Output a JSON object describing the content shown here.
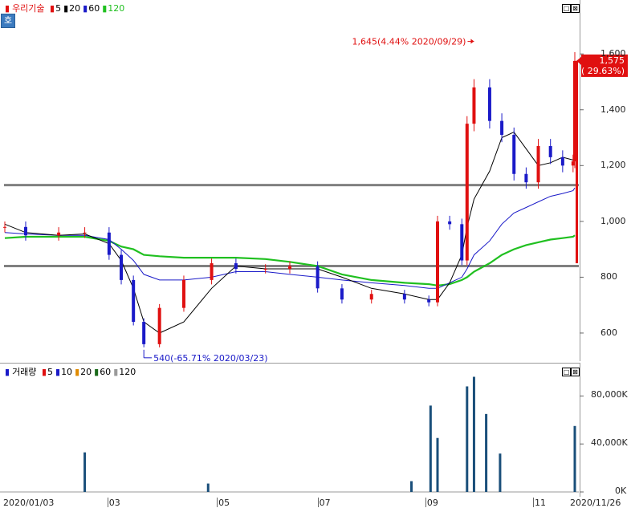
{
  "price_legend": {
    "stock_name": "우리기술",
    "ma_items": [
      {
        "label": "5",
        "color": "#e01010"
      },
      {
        "label": "20",
        "color": "#000000"
      },
      {
        "label": "60",
        "color": "#1a1ac8"
      },
      {
        "label": "120",
        "color": "#20c020"
      }
    ]
  },
  "volume_legend": {
    "title": "거래량",
    "ma_items": [
      {
        "label": "5",
        "color": "#e01010"
      },
      {
        "label": "10",
        "color": "#1a1ac8"
      },
      {
        "label": "20",
        "color": "#e08a00"
      },
      {
        "label": "60",
        "color": "#1a6a1a"
      },
      {
        "label": "120",
        "color": "#9a9a9a"
      }
    ]
  },
  "menu_chip": "호",
  "window_buttons": [
    "□",
    "⊠"
  ],
  "annotations": {
    "high": "1,645(4.44% 2020/09/29)",
    "low": "540(-65.71% 2020/03/23)",
    "last_price": "1,575",
    "last_change": "( 29.63%)"
  },
  "x_labels": {
    "start_date": "2020/01/03",
    "end_date": "2020/11/26",
    "months": [
      "03",
      "05",
      "07",
      "09",
      "11"
    ]
  },
  "colors": {
    "up": "#e01010",
    "down": "#1a1ac8",
    "support_line": "#808080",
    "ma120": "#20c020"
  },
  "chart_data": [
    {
      "type": "candlestick",
      "title": "우리기술",
      "y_ticks": [
        "1,600",
        "1,400",
        "1,200",
        "1,000",
        "800",
        "600"
      ],
      "y_tick_values": [
        1600,
        1400,
        1200,
        1000,
        800,
        600
      ],
      "ylim": [
        505,
        1730
      ],
      "horizontal_lines": [
        1130,
        840
      ],
      "close_series": [
        {
          "date": "2020/01/03",
          "close": 980
        },
        {
          "date": "2020/01/15",
          "close": 950
        },
        {
          "date": "2020/02/03",
          "close": 960
        },
        {
          "date": "2020/02/18",
          "close": 960
        },
        {
          "date": "2020/03/03",
          "close": 880
        },
        {
          "date": "2020/03/10",
          "close": 790
        },
        {
          "date": "2020/03/17",
          "close": 640
        },
        {
          "date": "2020/03/23",
          "close": 560
        },
        {
          "date": "2020/04/01",
          "close": 690
        },
        {
          "date": "2020/04/15",
          "close": 790
        },
        {
          "date": "2020/05/01",
          "close": 850
        },
        {
          "date": "2020/05/15",
          "close": 830
        },
        {
          "date": "2020/06/01",
          "close": 830
        },
        {
          "date": "2020/06/15",
          "close": 840
        },
        {
          "date": "2020/07/01",
          "close": 760
        },
        {
          "date": "2020/07/15",
          "close": 720
        },
        {
          "date": "2020/08/01",
          "close": 740
        },
        {
          "date": "2020/08/20",
          "close": 720
        },
        {
          "date": "2020/09/03",
          "close": 710
        },
        {
          "date": "2020/09/08",
          "close": 1000
        },
        {
          "date": "2020/09/15",
          "close": 990
        },
        {
          "date": "2020/09/22",
          "close": 860
        },
        {
          "date": "2020/09/25",
          "close": 1350
        },
        {
          "date": "2020/09/29",
          "close": 1480
        },
        {
          "date": "2020/10/08",
          "close": 1360
        },
        {
          "date": "2020/10/15",
          "close": 1310
        },
        {
          "date": "2020/10/22",
          "close": 1170
        },
        {
          "date": "2020/10/29",
          "close": 1140
        },
        {
          "date": "2020/11/05",
          "close": 1270
        },
        {
          "date": "2020/11/12",
          "close": 1230
        },
        {
          "date": "2020/11/19",
          "close": 1200
        },
        {
          "date": "2020/11/25",
          "close": 1215
        },
        {
          "date": "2020/11/26",
          "close": 1575
        }
      ],
      "high": {
        "date": "2020/09/29",
        "value": 1645
      },
      "low": {
        "date": "2020/03/23",
        "value": 540
      },
      "ma20": [
        990,
        960,
        950,
        955,
        920,
        860,
        760,
        640,
        600,
        640,
        760,
        840,
        830,
        830,
        830,
        800,
        760,
        740,
        720,
        720,
        780,
        880,
        980,
        1080,
        1180,
        1300,
        1320,
        1260,
        1200,
        1210,
        1230,
        1220,
        1240
      ],
      "ma60": [
        960,
        955,
        950,
        950,
        935,
        900,
        860,
        810,
        790,
        790,
        800,
        820,
        820,
        810,
        800,
        790,
        780,
        770,
        760,
        760,
        780,
        800,
        830,
        880,
        930,
        990,
        1030,
        1050,
        1070,
        1090,
        1100,
        1110,
        1120
      ],
      "ma120": [
        940,
        945,
        945,
        945,
        930,
        910,
        900,
        880,
        875,
        870,
        870,
        870,
        865,
        855,
        840,
        810,
        790,
        780,
        775,
        770,
        775,
        790,
        800,
        820,
        850,
        880,
        900,
        915,
        925,
        935,
        940,
        945,
        950
      ]
    },
    {
      "type": "bar",
      "title": "거래량",
      "y_ticks": [
        "80,000K",
        "40,000K",
        "0K"
      ],
      "y_tick_values": [
        80000,
        40000,
        0
      ],
      "ylim": [
        0,
        95000
      ],
      "spikes": [
        {
          "date": "2020/02/18",
          "value": 33000
        },
        {
          "date": "2020/04/29",
          "value": 7000
        },
        {
          "date": "2020/08/24",
          "value": 9000
        },
        {
          "date": "2020/09/04",
          "value": 72000
        },
        {
          "date": "2020/09/08",
          "value": 45000
        },
        {
          "date": "2020/09/25",
          "value": 88000
        },
        {
          "date": "2020/09/29",
          "value": 96000
        },
        {
          "date": "2020/10/06",
          "value": 65000
        },
        {
          "date": "2020/10/14",
          "value": 32000
        },
        {
          "date": "2020/11/26",
          "value": 55000
        }
      ]
    }
  ]
}
